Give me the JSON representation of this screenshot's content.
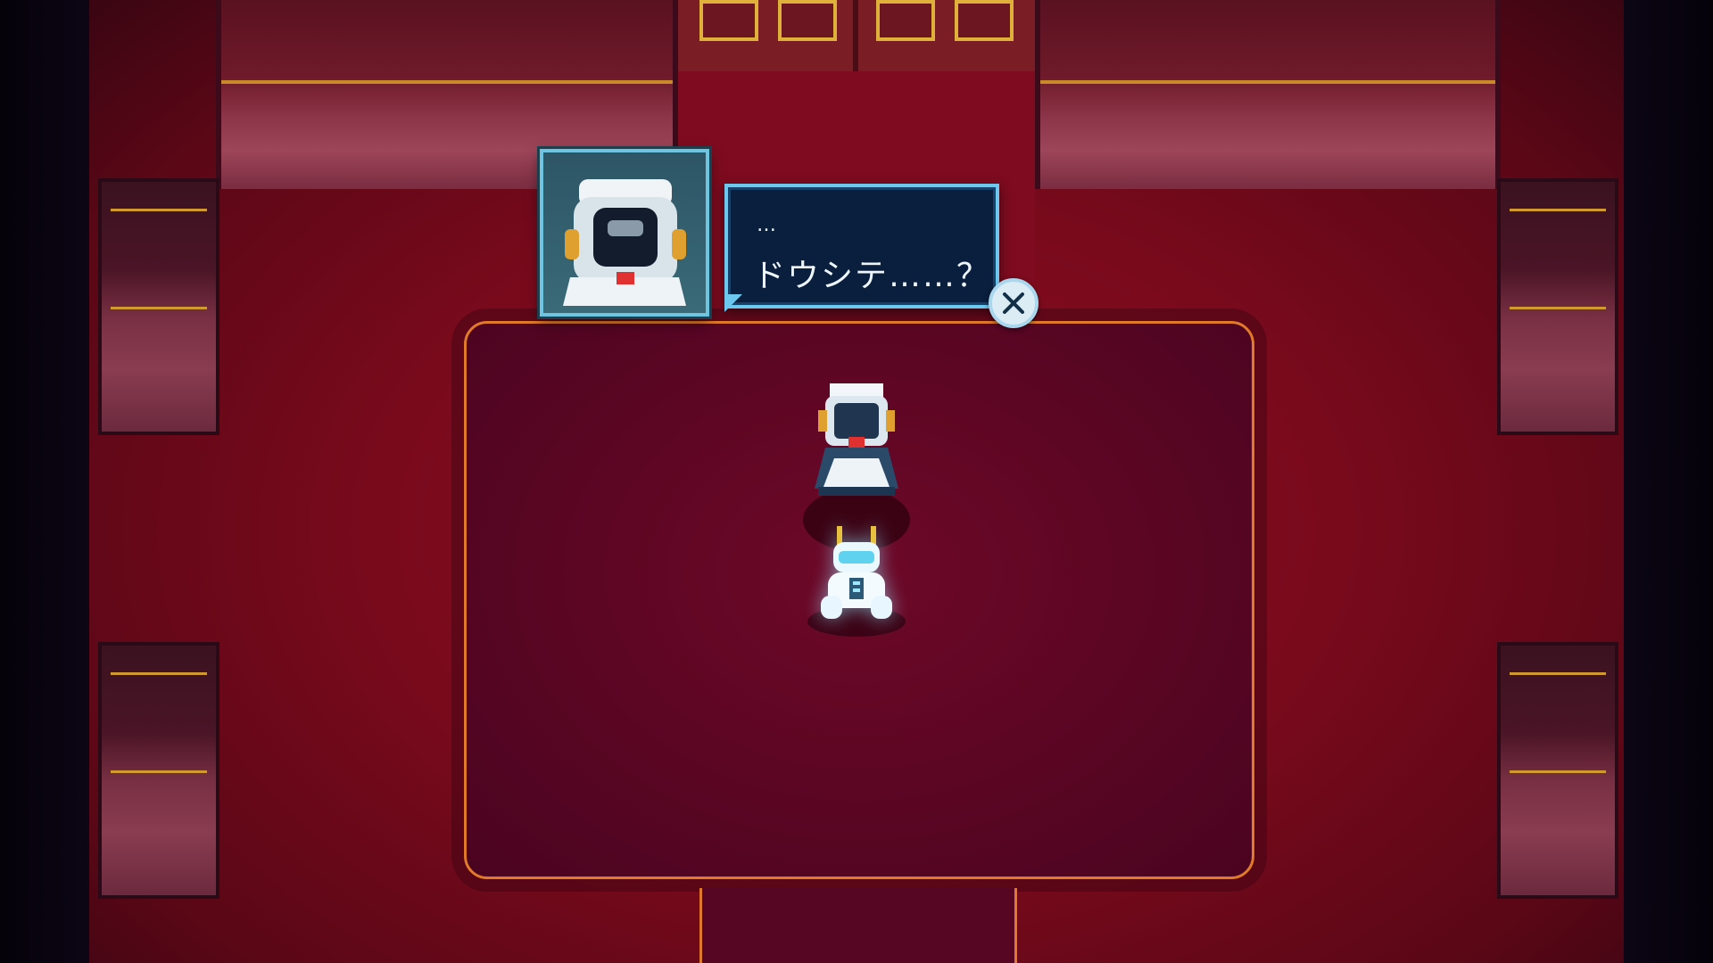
{
  "dialog": {
    "line1": "…",
    "line2": "ドウシテ……？"
  },
  "icons": {
    "close": "close-x-icon",
    "portrait": "maid-robot-portrait",
    "npc": "maid-robot-sprite",
    "player": "player-robot-sprite"
  },
  "colors": {
    "floor": "#780a1c",
    "carpet": "#5a0623",
    "carpet_border": "#e07a2a",
    "dialog_bg": "#0a1f3d",
    "dialog_border": "#6cc8ee",
    "trim_gold": "#c98a2a"
  }
}
